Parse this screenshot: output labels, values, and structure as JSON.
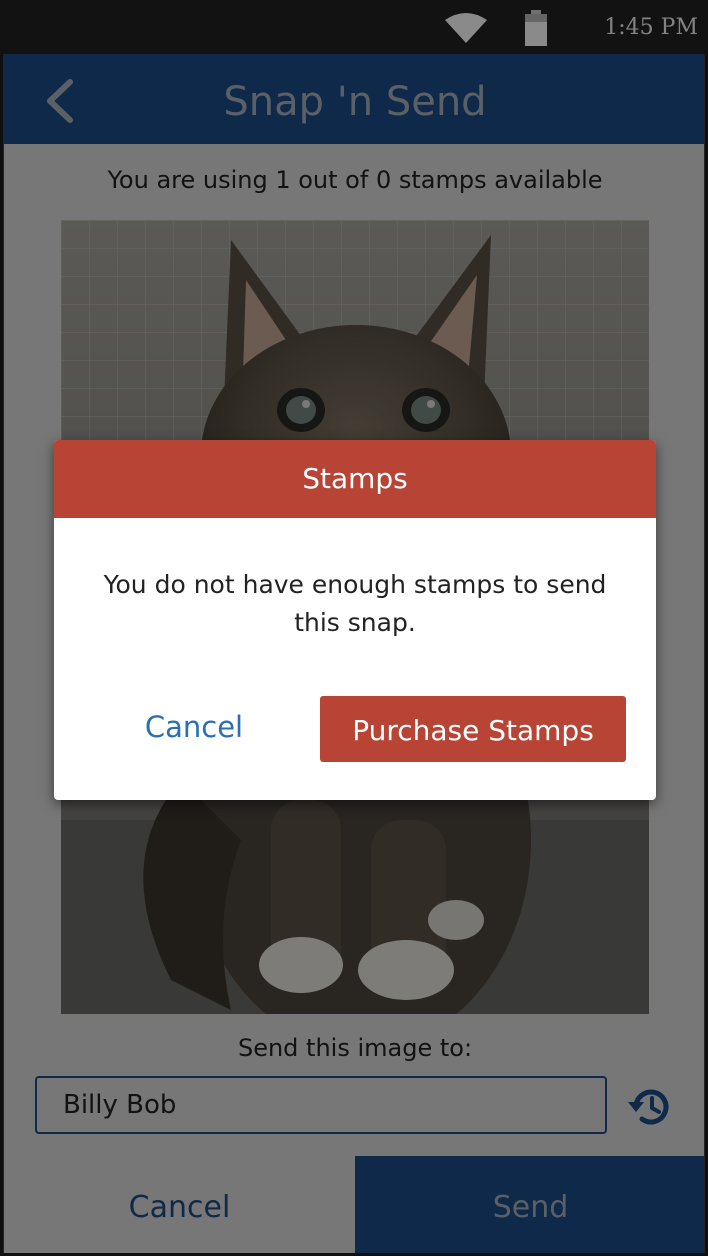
{
  "status_bar": {
    "time": "1:45 PM",
    "icons": [
      "wifi-icon",
      "battery-icon"
    ]
  },
  "app_bar": {
    "back_icon": "chevron-left-icon",
    "title": "Snap 'n Send"
  },
  "usage_text": "You are using 1 out of 0 stamps available",
  "photo": {
    "subject": "kitten-photo"
  },
  "send_to": {
    "label": "Send this image to:",
    "recipient_value": "Billy Bob",
    "history_icon": "history-icon"
  },
  "bottom_bar": {
    "cancel_label": "Cancel",
    "send_label": "Send"
  },
  "dialog": {
    "title": "Stamps",
    "message": "You do not have enough stamps to send this snap.",
    "cancel_label": "Cancel",
    "purchase_label": "Purchase Stamps"
  },
  "colors": {
    "app_bar": "#1b4d87",
    "dialog_accent": "#b84436",
    "link": "#2a6fb3"
  }
}
